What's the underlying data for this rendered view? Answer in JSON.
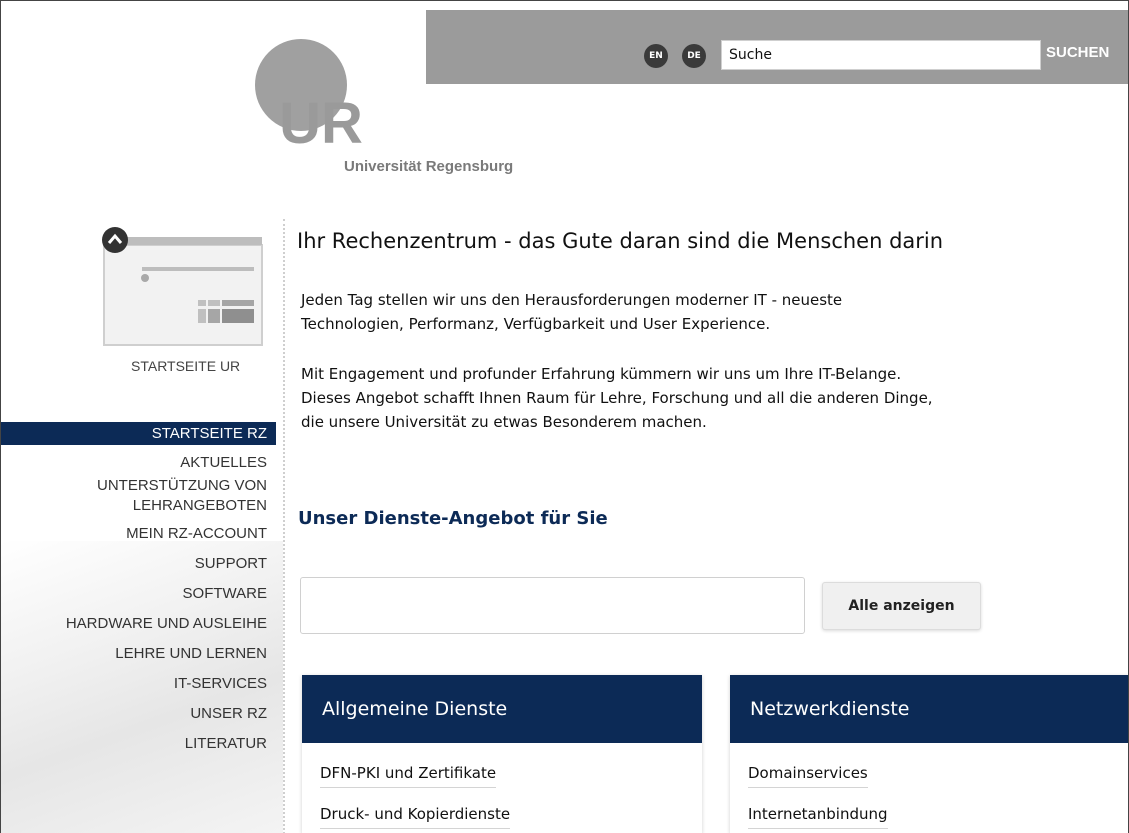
{
  "header": {
    "lang_en": "EN",
    "lang_de": "DE",
    "search_value": "Suche",
    "search_button": "SUCHEN"
  },
  "logo": {
    "mark": "UR",
    "caption": "Universität Regensburg"
  },
  "sidebar": {
    "home_link": "STARTSEITE UR",
    "items": [
      {
        "label": "STARTSEITE RZ",
        "active": true
      },
      {
        "label": "AKTUELLES"
      },
      {
        "label": "UNTERSTÜTZUNG VON"
      },
      {
        "label": "LEHRANGEBOTEN"
      },
      {
        "label": "MEIN RZ-ACCOUNT"
      },
      {
        "label": "SUPPORT"
      },
      {
        "label": "SOFTWARE"
      },
      {
        "label": "HARDWARE UND AUSLEIHE"
      },
      {
        "label": "LEHRE UND LERNEN"
      },
      {
        "label": "IT-SERVICES"
      },
      {
        "label": "UNSER RZ"
      },
      {
        "label": "LITERATUR"
      }
    ]
  },
  "main": {
    "title": "Ihr Rechenzentrum - das Gute daran sind die Menschen darin",
    "para1_line1": "Jeden Tag stellen wir uns den Herausforderungen moderner IT - neueste",
    "para1_line2": "Technologien, Performanz, Verfügbarkeit und User Experience.",
    "para2_line1": "Mit Engagement und profunder Erfahrung kümmern wir uns um Ihre IT-Belange.",
    "para2_line2": "Dieses Angebot schafft Ihnen Raum für Lehre, Forschung und all die anderen Dinge,",
    "para2_line3": "die unsere Universität zu etwas Besonderem machen.",
    "services_title": "Unser Dienste-Angebot für Sie",
    "filter_value": "",
    "show_all_button": "Alle anzeigen"
  },
  "cards": [
    {
      "title": "Allgemeine Dienste",
      "links": [
        "DFN-PKI und Zertifikate",
        "Druck- und Kopierdienste"
      ]
    },
    {
      "title": "Netzwerkdienste",
      "links": [
        "Domainservices",
        "Internetanbindung"
      ]
    }
  ],
  "colors": {
    "navy": "#0c2a56",
    "topbar_grey": "#9b9b9b"
  },
  "icons": {
    "collapse": "chevron-up-icon",
    "ur_home": "website-thumbnail-icon"
  }
}
